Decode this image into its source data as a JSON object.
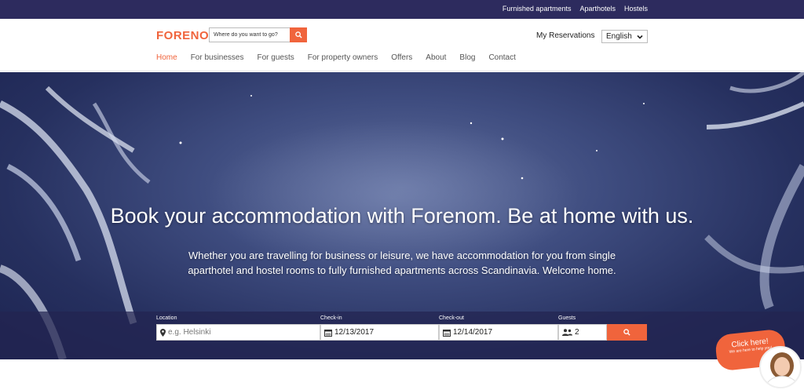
{
  "topbar": {
    "links": [
      "Furnished apartments",
      "Aparthotels",
      "Hostels"
    ]
  },
  "header": {
    "logo": "FORENOM",
    "search_placeholder": "Where do you want to go?",
    "my_reservations": "My Reservations",
    "language": "English",
    "nav": [
      "Home",
      "For businesses",
      "For guests",
      "For property owners",
      "Offers",
      "About",
      "Blog",
      "Contact"
    ],
    "active_nav": "Home"
  },
  "hero": {
    "title": "Book your accommodation with Forenom. Be at home with us.",
    "subtitle": "Whether you are travelling for business or leisure, we have accommodation for you from single aparthotel and hostel rooms to fully furnished apartments across Scandinavia. Welcome home."
  },
  "booking": {
    "location_label": "Location",
    "location_placeholder": "e.g. Helsinki",
    "checkin_label": "Check-in",
    "checkin_value": "12/13/2017",
    "checkout_label": "Check-out",
    "checkout_value": "12/14/2017",
    "guests_label": "Guests",
    "guests_value": "2"
  },
  "chat": {
    "title": "Click here!",
    "subtitle": "We are here to help you!"
  },
  "colors": {
    "accent": "#f0643c",
    "topbar": "#2d2b5e"
  }
}
